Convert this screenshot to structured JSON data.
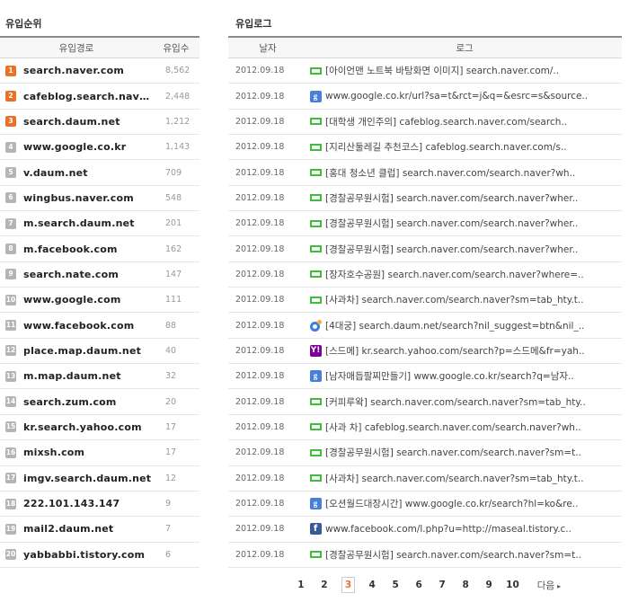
{
  "rank": {
    "title": "유입순위",
    "col_site": "유입경로",
    "col_count": "유입수",
    "rows": [
      {
        "num": "1",
        "site": "search.naver.com",
        "count": "8,562",
        "top": true
      },
      {
        "num": "2",
        "site": "cafeblog.search.naver.com",
        "count": "2,448",
        "top": true
      },
      {
        "num": "3",
        "site": "search.daum.net",
        "count": "1,212",
        "top": true
      },
      {
        "num": "4",
        "site": "www.google.co.kr",
        "count": "1,143",
        "top": false
      },
      {
        "num": "5",
        "site": "v.daum.net",
        "count": "709",
        "top": false
      },
      {
        "num": "6",
        "site": "wingbus.naver.com",
        "count": "548",
        "top": false
      },
      {
        "num": "7",
        "site": "m.search.daum.net",
        "count": "201",
        "top": false
      },
      {
        "num": "8",
        "site": "m.facebook.com",
        "count": "162",
        "top": false
      },
      {
        "num": "9",
        "site": "search.nate.com",
        "count": "147",
        "top": false
      },
      {
        "num": "10",
        "site": "www.google.com",
        "count": "111",
        "top": false
      },
      {
        "num": "11",
        "site": "www.facebook.com",
        "count": "88",
        "top": false
      },
      {
        "num": "12",
        "site": "place.map.daum.net",
        "count": "40",
        "top": false
      },
      {
        "num": "13",
        "site": "m.map.daum.net",
        "count": "32",
        "top": false
      },
      {
        "num": "14",
        "site": "search.zum.com",
        "count": "20",
        "top": false
      },
      {
        "num": "15",
        "site": "kr.search.yahoo.com",
        "count": "17",
        "top": false
      },
      {
        "num": "16",
        "site": "mixsh.com",
        "count": "17",
        "top": false
      },
      {
        "num": "17",
        "site": "imgv.search.daum.net",
        "count": "12",
        "top": false
      },
      {
        "num": "18",
        "site": "222.101.143.147",
        "count": "9",
        "top": false
      },
      {
        "num": "19",
        "site": "mail2.daum.net",
        "count": "7",
        "top": false
      },
      {
        "num": "20",
        "site": "yabbabbi.tistory.com",
        "count": "6",
        "top": false
      }
    ]
  },
  "log": {
    "title": "유입로그",
    "col_date": "날자",
    "col_log": "로그",
    "rows": [
      {
        "date": "2012.09.18",
        "icon": "naver-icon",
        "text": "[아이언맨 노트북 바탕화면 이미지] search.naver.com/.."
      },
      {
        "date": "2012.09.18",
        "icon": "google-icon",
        "text": "www.google.co.kr/url?sa=t&rct=j&q=&esrc=s&source.."
      },
      {
        "date": "2012.09.18",
        "icon": "naver-icon",
        "text": "[대학생 개인주의] cafeblog.search.naver.com/search.."
      },
      {
        "date": "2012.09.18",
        "icon": "naver-icon",
        "text": "[지리산둘레길 추천코스] cafeblog.search.naver.com/s.."
      },
      {
        "date": "2012.09.18",
        "icon": "naver-icon",
        "text": "[홍대 청소년 클럽] search.naver.com/search.naver?wh.."
      },
      {
        "date": "2012.09.18",
        "icon": "naver-icon",
        "text": "[경찰공무원시험] search.naver.com/search.naver?wher.."
      },
      {
        "date": "2012.09.18",
        "icon": "naver-icon",
        "text": "[경찰공무원시험] search.naver.com/search.naver?wher.."
      },
      {
        "date": "2012.09.18",
        "icon": "naver-icon",
        "text": "[경찰공무원시험] search.naver.com/search.naver?wher.."
      },
      {
        "date": "2012.09.18",
        "icon": "naver-icon",
        "text": "[장자호수공원] search.naver.com/search.naver?where=.."
      },
      {
        "date": "2012.09.18",
        "icon": "naver-icon",
        "text": "[사과차] search.naver.com/search.naver?sm=tab_hty.t.."
      },
      {
        "date": "2012.09.18",
        "icon": "daum-icon",
        "text": "[4대궁] search.daum.net/search?nil_suggest=btn&nil_.."
      },
      {
        "date": "2012.09.18",
        "icon": "yahoo-icon",
        "text": "[스드메] kr.search.yahoo.com/search?p=스드메&fr=yah.."
      },
      {
        "date": "2012.09.18",
        "icon": "google-icon",
        "text": "[남자매듭팔찌만들기] www.google.co.kr/search?q=남자.."
      },
      {
        "date": "2012.09.18",
        "icon": "naver-icon",
        "text": "[커피루왁] search.naver.com/search.naver?sm=tab_hty.."
      },
      {
        "date": "2012.09.18",
        "icon": "naver-icon",
        "text": "[사과 차] cafeblog.search.naver.com/search.naver?wh.."
      },
      {
        "date": "2012.09.18",
        "icon": "naver-icon",
        "text": "[경찰공무원시험] search.naver.com/search.naver?sm=t.."
      },
      {
        "date": "2012.09.18",
        "icon": "naver-icon",
        "text": "[사과차] search.naver.com/search.naver?sm=tab_hty.t.."
      },
      {
        "date": "2012.09.18",
        "icon": "google-icon",
        "text": "[오션월드대장시간] www.google.co.kr/search?hl=ko&re.."
      },
      {
        "date": "2012.09.18",
        "icon": "facebook-icon",
        "text": "www.facebook.com/l.php?u=http://maseal.tistory.c.."
      },
      {
        "date": "2012.09.18",
        "icon": "naver-icon",
        "text": "[경찰공무원시험] search.naver.com/search.naver?sm=t.."
      }
    ]
  },
  "pagination": {
    "pages": [
      "1",
      "2",
      "3",
      "4",
      "5",
      "6",
      "7",
      "8",
      "9",
      "10"
    ],
    "current": "3",
    "next_label": "다음",
    "next_arrow": "▸"
  },
  "colors": {
    "accent": "#e8722a",
    "naver": "#3fbe3a",
    "google": "#4a7fd9",
    "yahoo": "#7b0099",
    "facebook": "#3b5998"
  }
}
